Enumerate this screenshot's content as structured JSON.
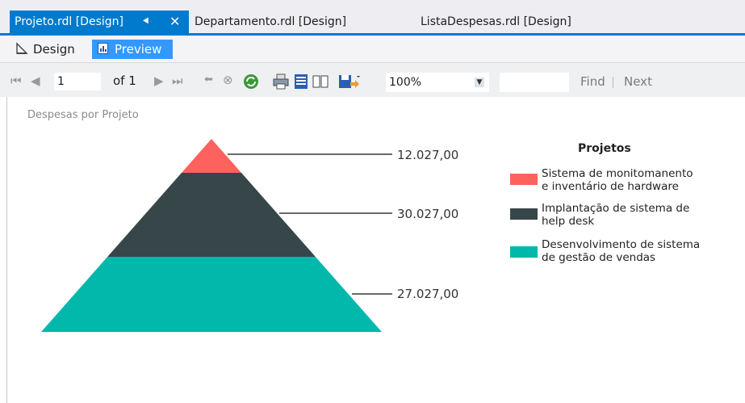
{
  "tabs": [
    {
      "label": "Projeto.rdl [Design]",
      "active": true
    },
    {
      "label": "Departamento.rdl [Design]",
      "active": false
    },
    {
      "label": "ListaDespesas.rdl [Design]",
      "active": false
    }
  ],
  "tab_icons": {
    "pin": "pin-icon",
    "close": "close-icon"
  },
  "view_tabs": {
    "design": "Design",
    "preview": "Preview",
    "selected": "Preview"
  },
  "toolbar": {
    "page_value": "1",
    "of_label": "of 1",
    "zoom_value": "100%",
    "find_label": "Find",
    "next_label": "Next",
    "find_value": "",
    "icons": [
      "first-page-icon",
      "previous-page-icon",
      "next-page-icon",
      "last-page-icon",
      "back-icon",
      "stop-icon",
      "refresh-icon",
      "print-icon",
      "print-layout-icon",
      "page-setup-icon",
      "export-icon"
    ]
  },
  "report": {
    "title": "Despesas por Projeto"
  },
  "chart_data": {
    "type": "pyramid",
    "legend_title": "Projetos",
    "legend_position": "right",
    "series": [
      {
        "name": "Sistema de monitomanento e inventário de hardware",
        "value": 12027,
        "label": "12.027,00",
        "color": "#fd625e"
      },
      {
        "name": "Implantação de sistema de help desk",
        "value": 30027,
        "label": "30.027,00",
        "color": "#374649"
      },
      {
        "name": "Desenvolvimento de sistema de gestão de vendas",
        "value": 27027,
        "label": "27.027,00",
        "color": "#01b8aa"
      }
    ]
  },
  "colors": {
    "accent": "#007acc",
    "preview_selected": "#3399ff"
  }
}
